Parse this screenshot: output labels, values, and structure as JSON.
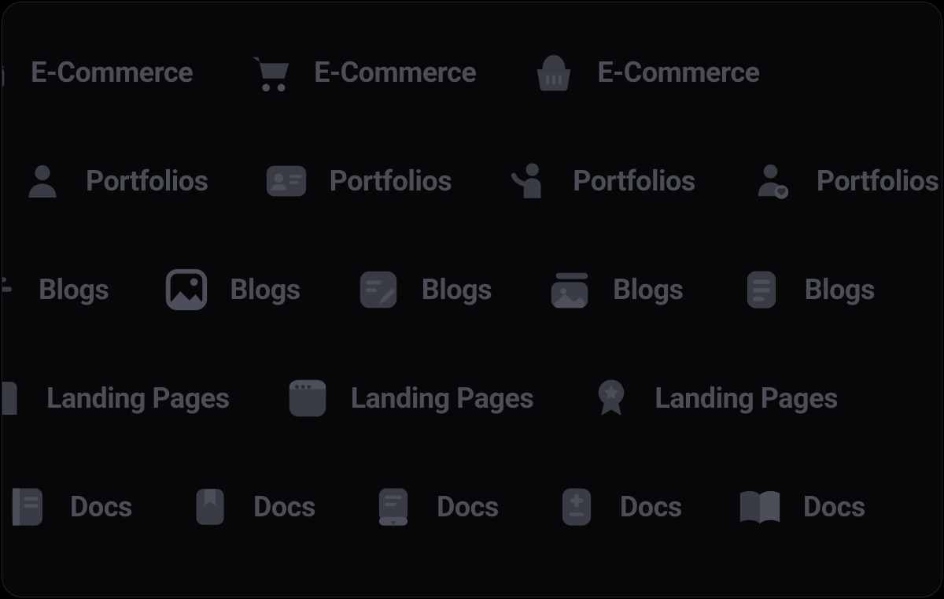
{
  "labels": {
    "ecommerce": "E-Commerce",
    "portfolios": "Portfolios",
    "blogs": "Blogs",
    "landing": "Landing Pages",
    "docs": "Docs"
  },
  "colors": {
    "background": "#070709",
    "border": "#24252b",
    "iconDark": "#3a3c45",
    "iconLight": "#4c4f5a",
    "text": "#4c4e57"
  },
  "rows": [
    {
      "name": "ecommerce",
      "icons": [
        "basket-icon",
        "cart-icon",
        "shopping-basket-icon"
      ]
    },
    {
      "name": "portfolios",
      "icons": [
        "user-icon",
        "id-card-icon",
        "person-wave-icon",
        "user-heart-icon"
      ]
    },
    {
      "name": "blogs",
      "icons": [
        "lines-icon",
        "image-icon",
        "edit-note-icon",
        "images-icon",
        "document-lines-icon"
      ]
    },
    {
      "name": "landing",
      "icons": [
        "sheet-icon",
        "window-icon",
        "award-icon"
      ]
    },
    {
      "name": "docs",
      "icons": [
        "notebook-icon",
        "bookmark-icon",
        "book-icon",
        "note-plus-icon",
        "open-book-icon"
      ]
    }
  ]
}
